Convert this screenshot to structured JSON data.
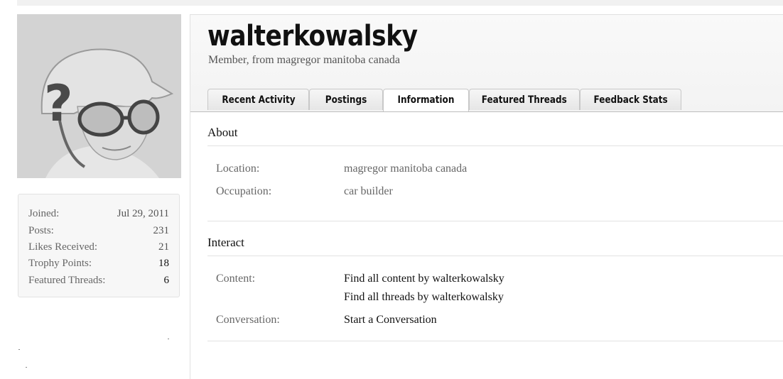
{
  "profile": {
    "username": "walterkowalsky",
    "title_line": "Member, from magregor manitoba canada"
  },
  "stats": [
    {
      "label": "Joined:",
      "value": "Jul 29, 2011"
    },
    {
      "label": "Posts:",
      "value": "231"
    },
    {
      "label": "Likes Received:",
      "value": "21"
    },
    {
      "label": "Trophy Points:",
      "value": "18"
    },
    {
      "label": "Featured Threads:",
      "value": "6"
    }
  ],
  "tabs": [
    {
      "label": "Recent Activity",
      "active": false
    },
    {
      "label": "Postings",
      "active": false
    },
    {
      "label": "Information",
      "active": true
    },
    {
      "label": "Featured Threads",
      "active": false
    },
    {
      "label": "Feedback Stats",
      "active": false
    }
  ],
  "about": {
    "heading": "About",
    "rows": [
      {
        "label": "Location:",
        "value": "magregor manitoba canada"
      },
      {
        "label": "Occupation:",
        "value": "car builder"
      }
    ]
  },
  "interact": {
    "heading": "Interact",
    "content_label": "Content:",
    "content_links": [
      "Find all content by walterkowalsky",
      "Find all threads by walterkowalsky"
    ],
    "conversation_label": "Conversation:",
    "conversation_link": "Start a Conversation"
  },
  "colors": {
    "header_bg": "#f4f4f4",
    "tab_bg": "#e8e8e8",
    "border": "#e1e1e1"
  }
}
